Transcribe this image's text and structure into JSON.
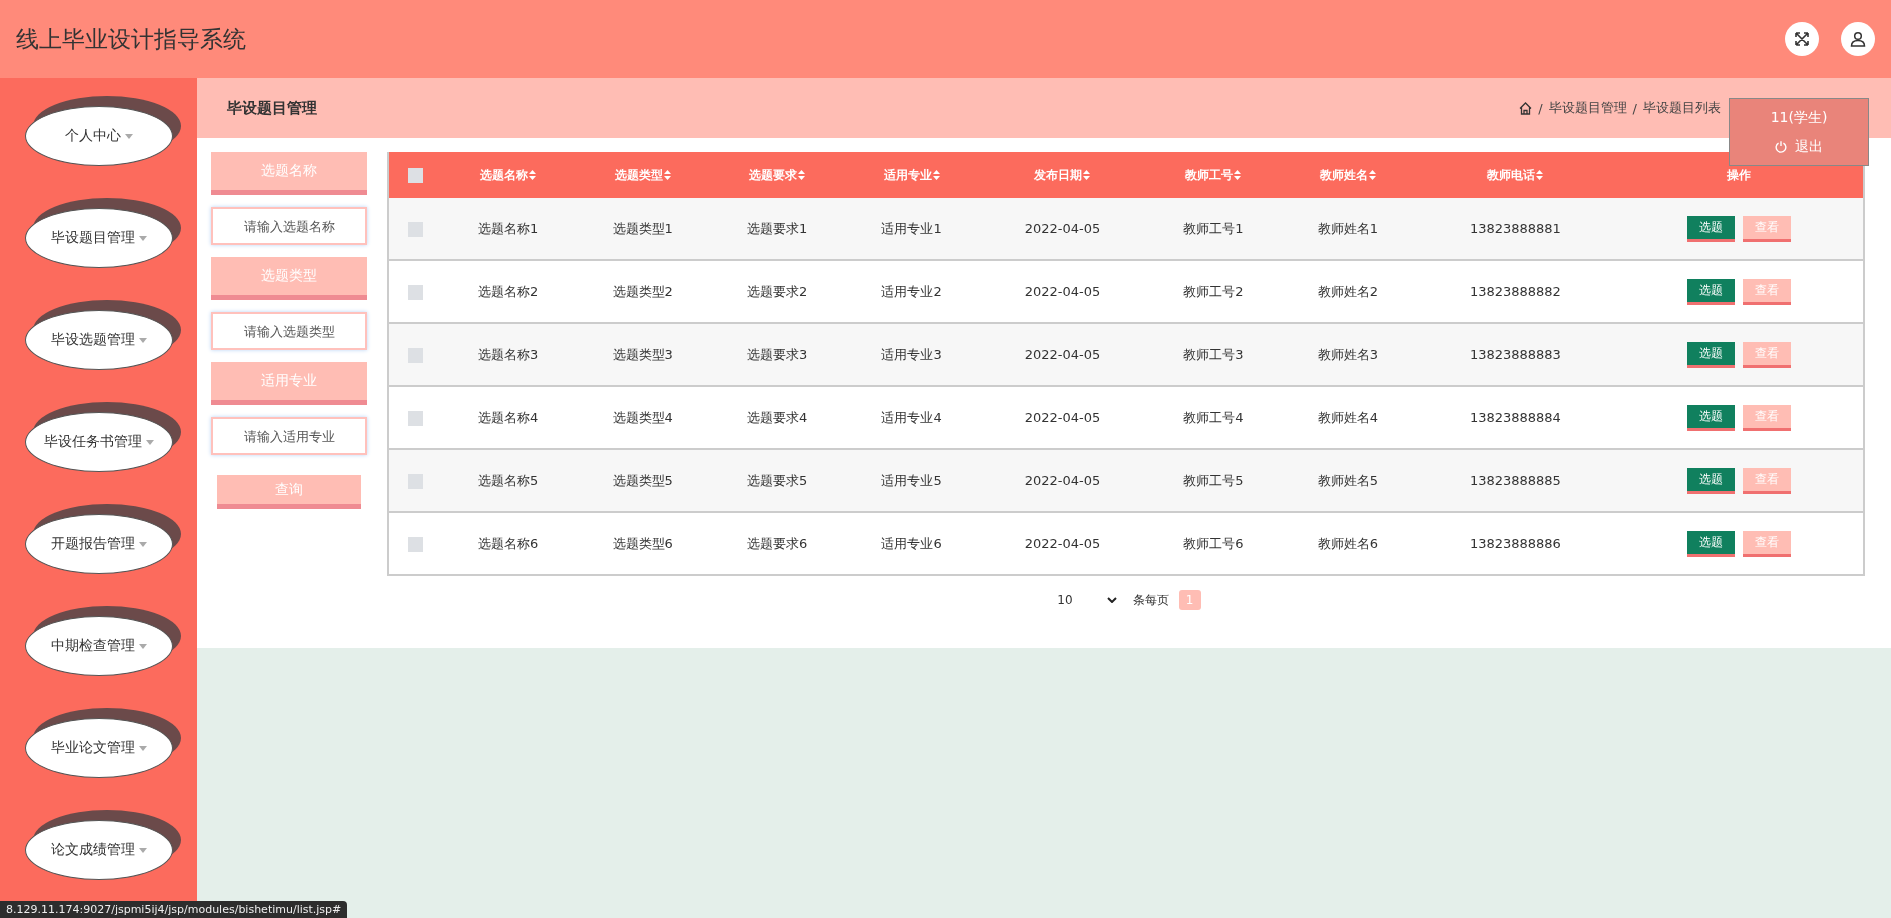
{
  "header": {
    "title": "线上毕业设计指导系统"
  },
  "user_menu": {
    "user": "11(学生)",
    "logout": "退出"
  },
  "sidebar": {
    "items": [
      {
        "label": "个人中心"
      },
      {
        "label": "毕设题目管理"
      },
      {
        "label": "毕设选题管理"
      },
      {
        "label": "毕设任务书管理"
      },
      {
        "label": "开题报告管理"
      },
      {
        "label": "中期检查管理"
      },
      {
        "label": "毕业论文管理"
      },
      {
        "label": "论文成绩管理"
      }
    ]
  },
  "page_title": "毕设题目管理",
  "breadcrumb": {
    "separator": "/",
    "items": [
      "毕设题目管理",
      "毕设题目列表"
    ]
  },
  "filters": [
    {
      "label": "选题名称",
      "placeholder": "请输入选题名称"
    },
    {
      "label": "选题类型",
      "placeholder": "请输入选题类型"
    },
    {
      "label": "适用专业",
      "placeholder": "请输入适用专业"
    }
  ],
  "search_button": "查询",
  "table": {
    "select_all_checked": false,
    "columns": [
      {
        "label": "选题名称",
        "sortable": true
      },
      {
        "label": "选题类型",
        "sortable": true
      },
      {
        "label": "选题要求",
        "sortable": true
      },
      {
        "label": "适用专业",
        "sortable": true
      },
      {
        "label": "发布日期",
        "sortable": true
      },
      {
        "label": "教师工号",
        "sortable": true
      },
      {
        "label": "教师姓名",
        "sortable": true
      },
      {
        "label": "教师电话",
        "sortable": true
      },
      {
        "label": "操作",
        "sortable": false
      }
    ],
    "rows": [
      {
        "checked": false,
        "cells": [
          "选题名称1",
          "选题类型1",
          "选题要求1",
          "适用专业1",
          "2022-04-05",
          "教师工号1",
          "教师姓名1",
          "13823888881"
        ],
        "actions": [
          "选题",
          "查看"
        ]
      },
      {
        "checked": false,
        "cells": [
          "选题名称2",
          "选题类型2",
          "选题要求2",
          "适用专业2",
          "2022-04-05",
          "教师工号2",
          "教师姓名2",
          "13823888882"
        ],
        "actions": [
          "选题",
          "查看"
        ]
      },
      {
        "checked": false,
        "cells": [
          "选题名称3",
          "选题类型3",
          "选题要求3",
          "适用专业3",
          "2022-04-05",
          "教师工号3",
          "教师姓名3",
          "13823888883"
        ],
        "actions": [
          "选题",
          "查看"
        ]
      },
      {
        "checked": false,
        "cells": [
          "选题名称4",
          "选题类型4",
          "选题要求4",
          "适用专业4",
          "2022-04-05",
          "教师工号4",
          "教师姓名4",
          "13823888884"
        ],
        "actions": [
          "选题",
          "查看"
        ]
      },
      {
        "checked": false,
        "cells": [
          "选题名称5",
          "选题类型5",
          "选题要求5",
          "适用专业5",
          "2022-04-05",
          "教师工号5",
          "教师姓名5",
          "13823888885"
        ],
        "actions": [
          "选题",
          "查看"
        ]
      },
      {
        "checked": false,
        "cells": [
          "选题名称6",
          "选题类型6",
          "选题要求6",
          "适用专业6",
          "2022-04-05",
          "教师工号6",
          "教师姓名6",
          "13823888886"
        ],
        "actions": [
          "选题",
          "查看"
        ]
      }
    ]
  },
  "pagination": {
    "page_size": "10",
    "per_page_label": "条每页",
    "pages": [
      {
        "label": "1",
        "selected": true
      }
    ]
  },
  "status_bar": {
    "url": "8.129.11.174:9027/jspmi5ij4/jsp/modules/bishetimu/list.jsp#"
  }
}
